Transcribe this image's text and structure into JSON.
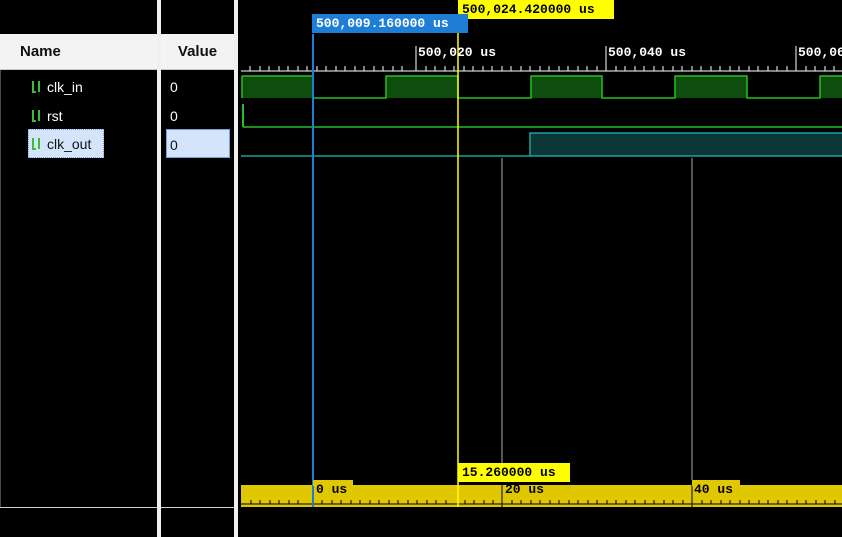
{
  "columns": {
    "name": "Name",
    "value": "Value"
  },
  "signals": [
    {
      "name": "clk_in",
      "value": "0",
      "selected": false,
      "icon": "bit-signal-icon"
    },
    {
      "name": "rst",
      "value": "0",
      "selected": false,
      "icon": "bit-signal-icon"
    },
    {
      "name": "clk_out",
      "value": "0",
      "selected": true,
      "icon": "bit-signal-icon"
    }
  ],
  "cursors": {
    "main": "500,024.420000 us",
    "marker": "500,009.160000 us",
    "delta": "15.260000 us"
  },
  "time_ruler": [
    "500,020 us",
    "500,040 us",
    "500,06"
  ],
  "delta_ruler": [
    "0 us",
    "20 us",
    "40 us"
  ],
  "colors": {
    "wave_green": "#22c022",
    "wave_fill": "#0e4d0e",
    "wave_teal": "#1aa0a0",
    "teal_fill": "#0b3737",
    "cursor_yellow": "#ffff00",
    "marker_blue": "#1e7ed6",
    "ruler_yellow": "#e0c800"
  }
}
